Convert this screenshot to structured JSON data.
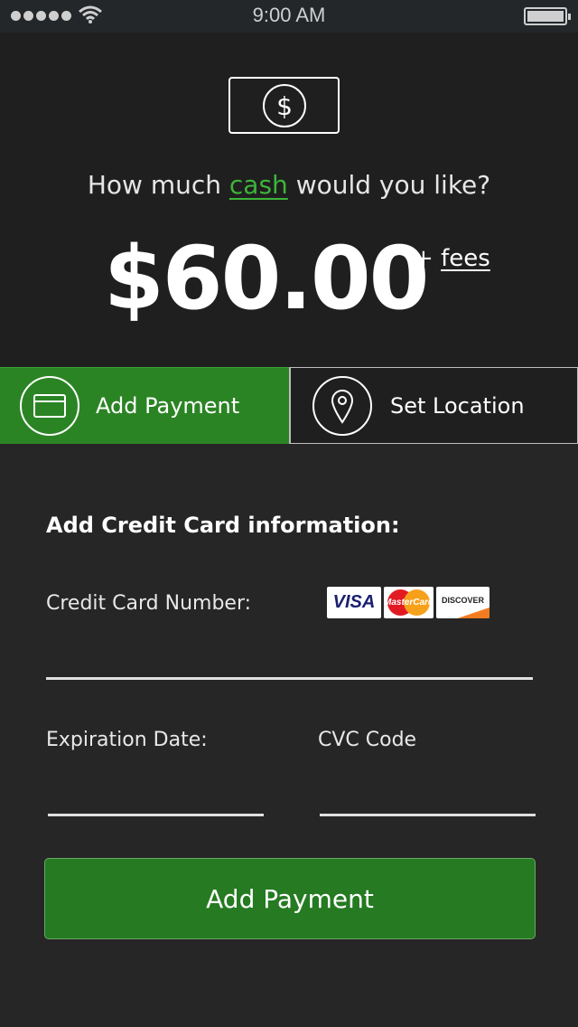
{
  "status_bar": {
    "time": "9:00 AM"
  },
  "header": {
    "question_prefix": "How much ",
    "question_highlight": "cash",
    "question_suffix": " would you like?",
    "amount": "$60.00",
    "fees_plus": "+ ",
    "fees_link": "fees"
  },
  "tabs": [
    {
      "label": "Add Payment",
      "icon": "credit-card-icon",
      "active": true
    },
    {
      "label": "Set Location",
      "icon": "map-pin-icon",
      "active": false
    }
  ],
  "form": {
    "heading": "Add Credit Card information:",
    "card_number_label": "Credit Card Number:",
    "card_number_value": "",
    "expiration_label": "Expiration Date:",
    "expiration_value": "",
    "cvc_label": "CVC Code",
    "cvc_value": "",
    "accepted_cards": [
      {
        "name": "VISA",
        "icon": "visa-logo"
      },
      {
        "name": "MasterCard",
        "icon": "mastercard-logo"
      },
      {
        "name": "DISCOVER",
        "icon": "discover-logo"
      }
    ],
    "submit_label": "Add Payment"
  },
  "colors": {
    "accent_green": "#2b8424",
    "highlight_green": "#3db53a",
    "background": "#262626"
  }
}
